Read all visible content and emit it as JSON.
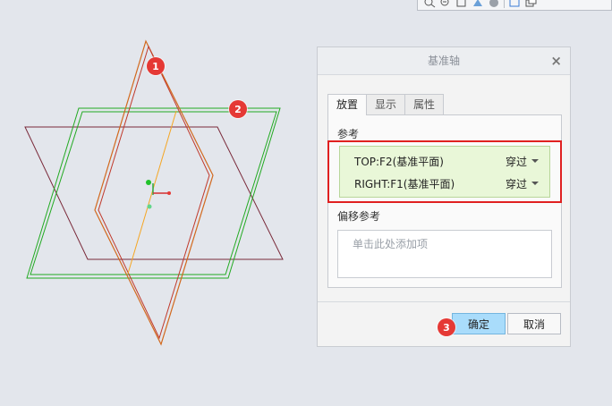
{
  "dialog": {
    "title": "基准轴",
    "close_glyph": "×",
    "tabs": [
      {
        "label": "放置",
        "active": true
      },
      {
        "label": "显示",
        "active": false
      },
      {
        "label": "属性",
        "active": false
      }
    ],
    "references_label": "参考",
    "references": [
      {
        "name": "TOP:F2(基准平面)",
        "type": "穿过"
      },
      {
        "name": "RIGHT:F1(基准平面)",
        "type": "穿过"
      }
    ],
    "offset_label": "偏移参考",
    "offset_placeholder": "单击此处添加项",
    "ok_label": "确定",
    "cancel_label": "取消"
  },
  "callouts": [
    "1",
    "2",
    "3"
  ],
  "colors": {
    "background": "#e3e6ec",
    "plane_orange": "#d2691e",
    "plane_green": "#22aa22",
    "plane_maroon": "#7a2a3a",
    "callout_red": "#e53935",
    "highlight_red": "#e02020",
    "ok_blue": "#a9dcfb",
    "ref_green": "#e9f7d8"
  },
  "toolbar_icons": [
    "zoom-in-icon",
    "zoom-out-icon",
    "refit-icon",
    "view-orient-icon",
    "display-style-icon",
    "saved-views-icon",
    "datum-display-icon"
  ]
}
